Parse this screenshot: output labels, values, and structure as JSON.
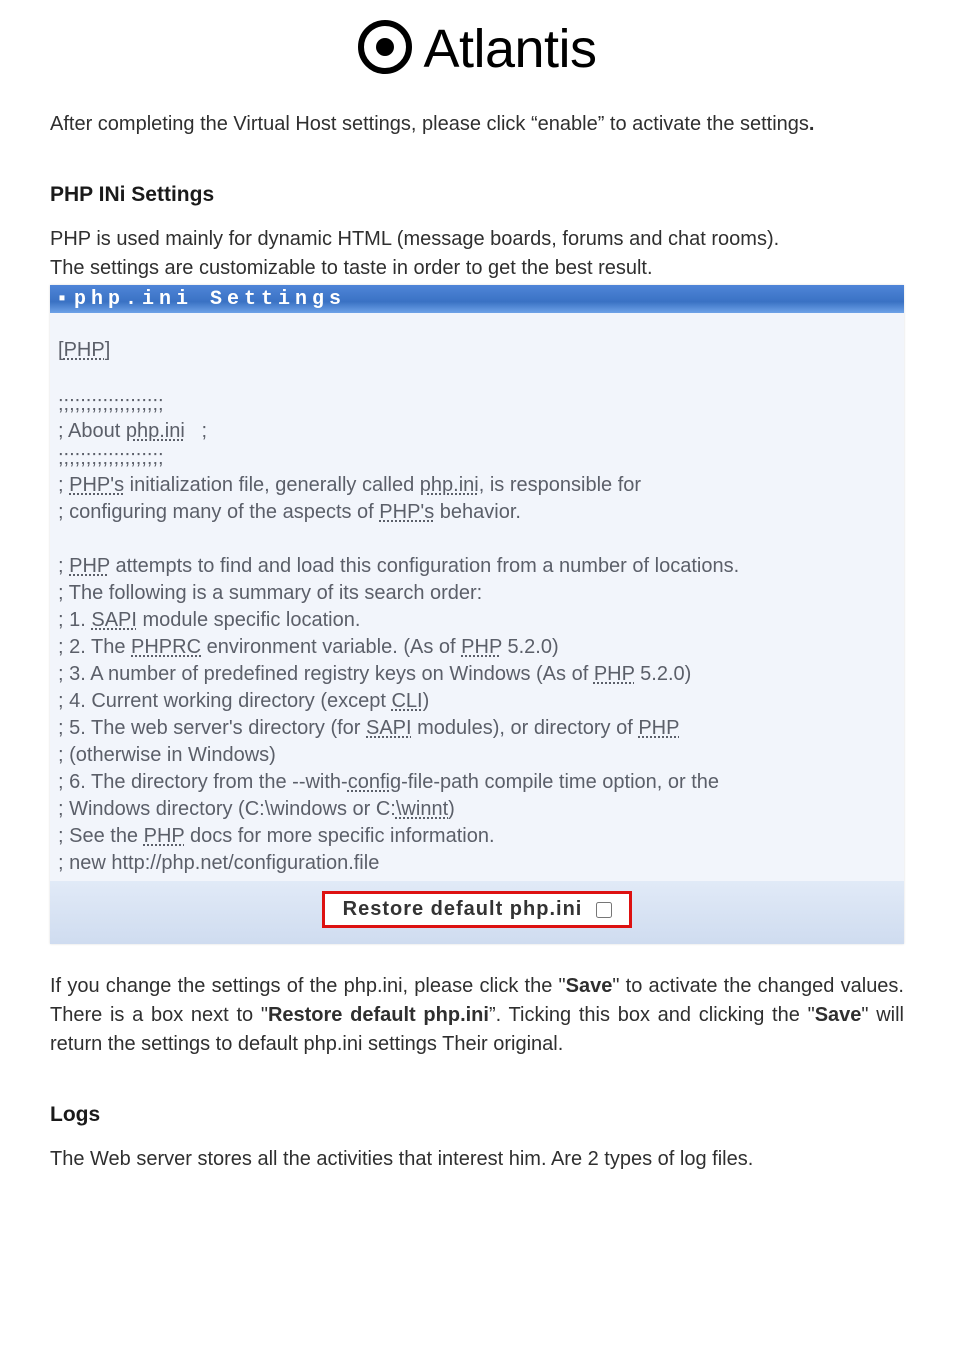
{
  "logo": {
    "brand": "Atlantis"
  },
  "intro": {
    "text_before_quote": "After completing the Virtual Host settings, please click ",
    "quoted": "“enable”",
    "text_after_quote": " to activate the settings",
    "trailing_period": "."
  },
  "php_section": {
    "heading": "PHP INi Settings",
    "desc_line1": "PHP is used mainly for dynamic HTML (message boards, forums and chat rooms).",
    "desc_line2": "The settings are customizable to taste in order to get the best result.",
    "panel_title": "php.ini Settings",
    "code": {
      "l1_open": "[",
      "l1_php": "PHP",
      "l1_close": "]",
      "sep": ";;;;;;;;;;;;;;;;;;;",
      "about1": "; About ",
      "about_php_ini": "php.ini",
      "about2": "   ;",
      "p1a": "; ",
      "p1_phps": "PHP's",
      "p1b": " initialization file, generally called ",
      "p1_phpini": "php.ini",
      "p1c": ", is responsible for",
      "p1d": "; configuring many of the aspects of ",
      "p1_phps2": "PHP's",
      "p1e": " behavior.",
      "p2a": "; ",
      "p2_php": "PHP",
      "p2b": " attempts to find and load this configuration from a number of locations.",
      "p2c": "; The following is a summary of its search order:",
      "s1a": "; 1. ",
      "s1_sapi": "SAPI",
      "s1b": " module specific location.",
      "s2a": "; 2. The ",
      "s2_phprc": "PHPRC",
      "s2b": " environment variable. (As of ",
      "s2_php": "PHP",
      "s2c": " 5.2.0)",
      "s3a": "; 3. A number of predefined registry keys on Windows (As of ",
      "s3_php": "PHP",
      "s3b": " 5.2.0)",
      "s4a": "; 4. Current working directory (except ",
      "s4_cli": "CLI",
      "s4b": ")",
      "s5a": "; 5. The web server's directory (for ",
      "s5_sapi": "SAPI",
      "s5b": " modules), or directory of ",
      "s5_php": "PHP",
      "s5c": "; (otherwise in Windows)",
      "s6a": "; 6. The directory from the --with-",
      "s6_config": "config",
      "s6b": "-file-path compile time option, or the",
      "s6c": "; Windows directory (C:\\windows or C:",
      "s6_winnt": "\\winnt",
      "s6d": ")",
      "s7a": "; See the ",
      "s7_php": "PHP",
      "s7b": " docs for more specific information.",
      "s8": "; new http://php.net/configuration.file"
    },
    "restore_label": "Restore default php.ini"
  },
  "post_panel": {
    "t1": "If you change the settings of the php.ini, please click the \"",
    "save1": "Save",
    "t2": "\" to activate the changed values. There is a box next to \"",
    "restore": "Restore default php.ini",
    "t3": "”. Ticking this box and clicking the \"",
    "save2": "Save",
    "t4": "\" will return the settings to default php.ini settings Their original."
  },
  "logs": {
    "heading": "Logs",
    "text": "The Web server stores all the activities that interest him. Are 2 types of log files."
  }
}
